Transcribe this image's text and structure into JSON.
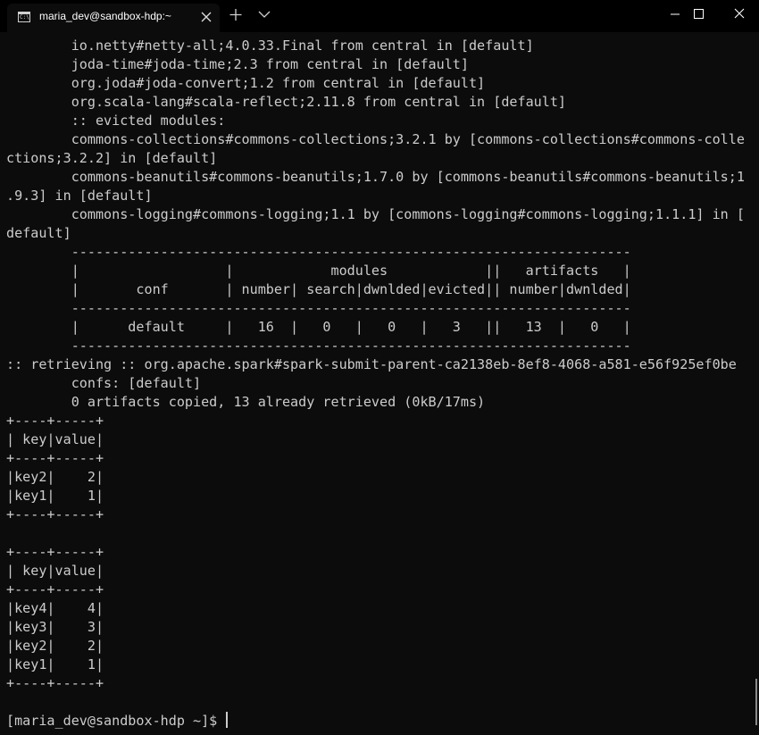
{
  "window": {
    "tab_title": "maria_dev@sandbox-hdp:~",
    "tab_icon": "terminal-icon",
    "icon_text": "C:\\",
    "new_tab_symbol": "+",
    "dropdown_symbol": "⌵",
    "colors": {
      "titlebar": "#000000",
      "background": "#0c0c0c",
      "text": "#cccccc"
    }
  },
  "terminal": {
    "lines": [
      "        io.netty#netty-all;4.0.33.Final from central in [default]",
      "        joda-time#joda-time;2.3 from central in [default]",
      "        org.joda#joda-convert;1.2 from central in [default]",
      "        org.scala-lang#scala-reflect;2.11.8 from central in [default]",
      "        :: evicted modules:",
      "        commons-collections#commons-collections;3.2.1 by [commons-collections#commons-colle",
      "ctions;3.2.2] in [default]",
      "        commons-beanutils#commons-beanutils;1.7.0 by [commons-beanutils#commons-beanutils;1",
      ".9.3] in [default]",
      "        commons-logging#commons-logging;1.1 by [commons-logging#commons-logging;1.1.1] in [",
      "default]",
      "        ---------------------------------------------------------------------",
      "        |                  |            modules            ||   artifacts   |",
      "        |       conf       | number| search|dwnlded|evicted|| number|dwnlded|",
      "        ---------------------------------------------------------------------",
      "        |      default     |   16  |   0   |   0   |   3   ||   13  |   0   |",
      "        ---------------------------------------------------------------------",
      ":: retrieving :: org.apache.spark#spark-submit-parent-ca2138eb-8ef8-4068-a581-e56f925ef0be",
      "        confs: [default]",
      "        0 artifacts copied, 13 already retrieved (0kB/17ms)",
      "+----+-----+",
      "| key|value|",
      "+----+-----+",
      "|key2|    2|",
      "|key1|    1|",
      "+----+-----+",
      "",
      "+----+-----+",
      "| key|value|",
      "+----+-----+",
      "|key4|    4|",
      "|key3|    3|",
      "|key2|    2|",
      "|key1|    1|",
      "+----+-----+",
      "",
      "[maria_dev@sandbox-hdp ~]$ "
    ]
  }
}
